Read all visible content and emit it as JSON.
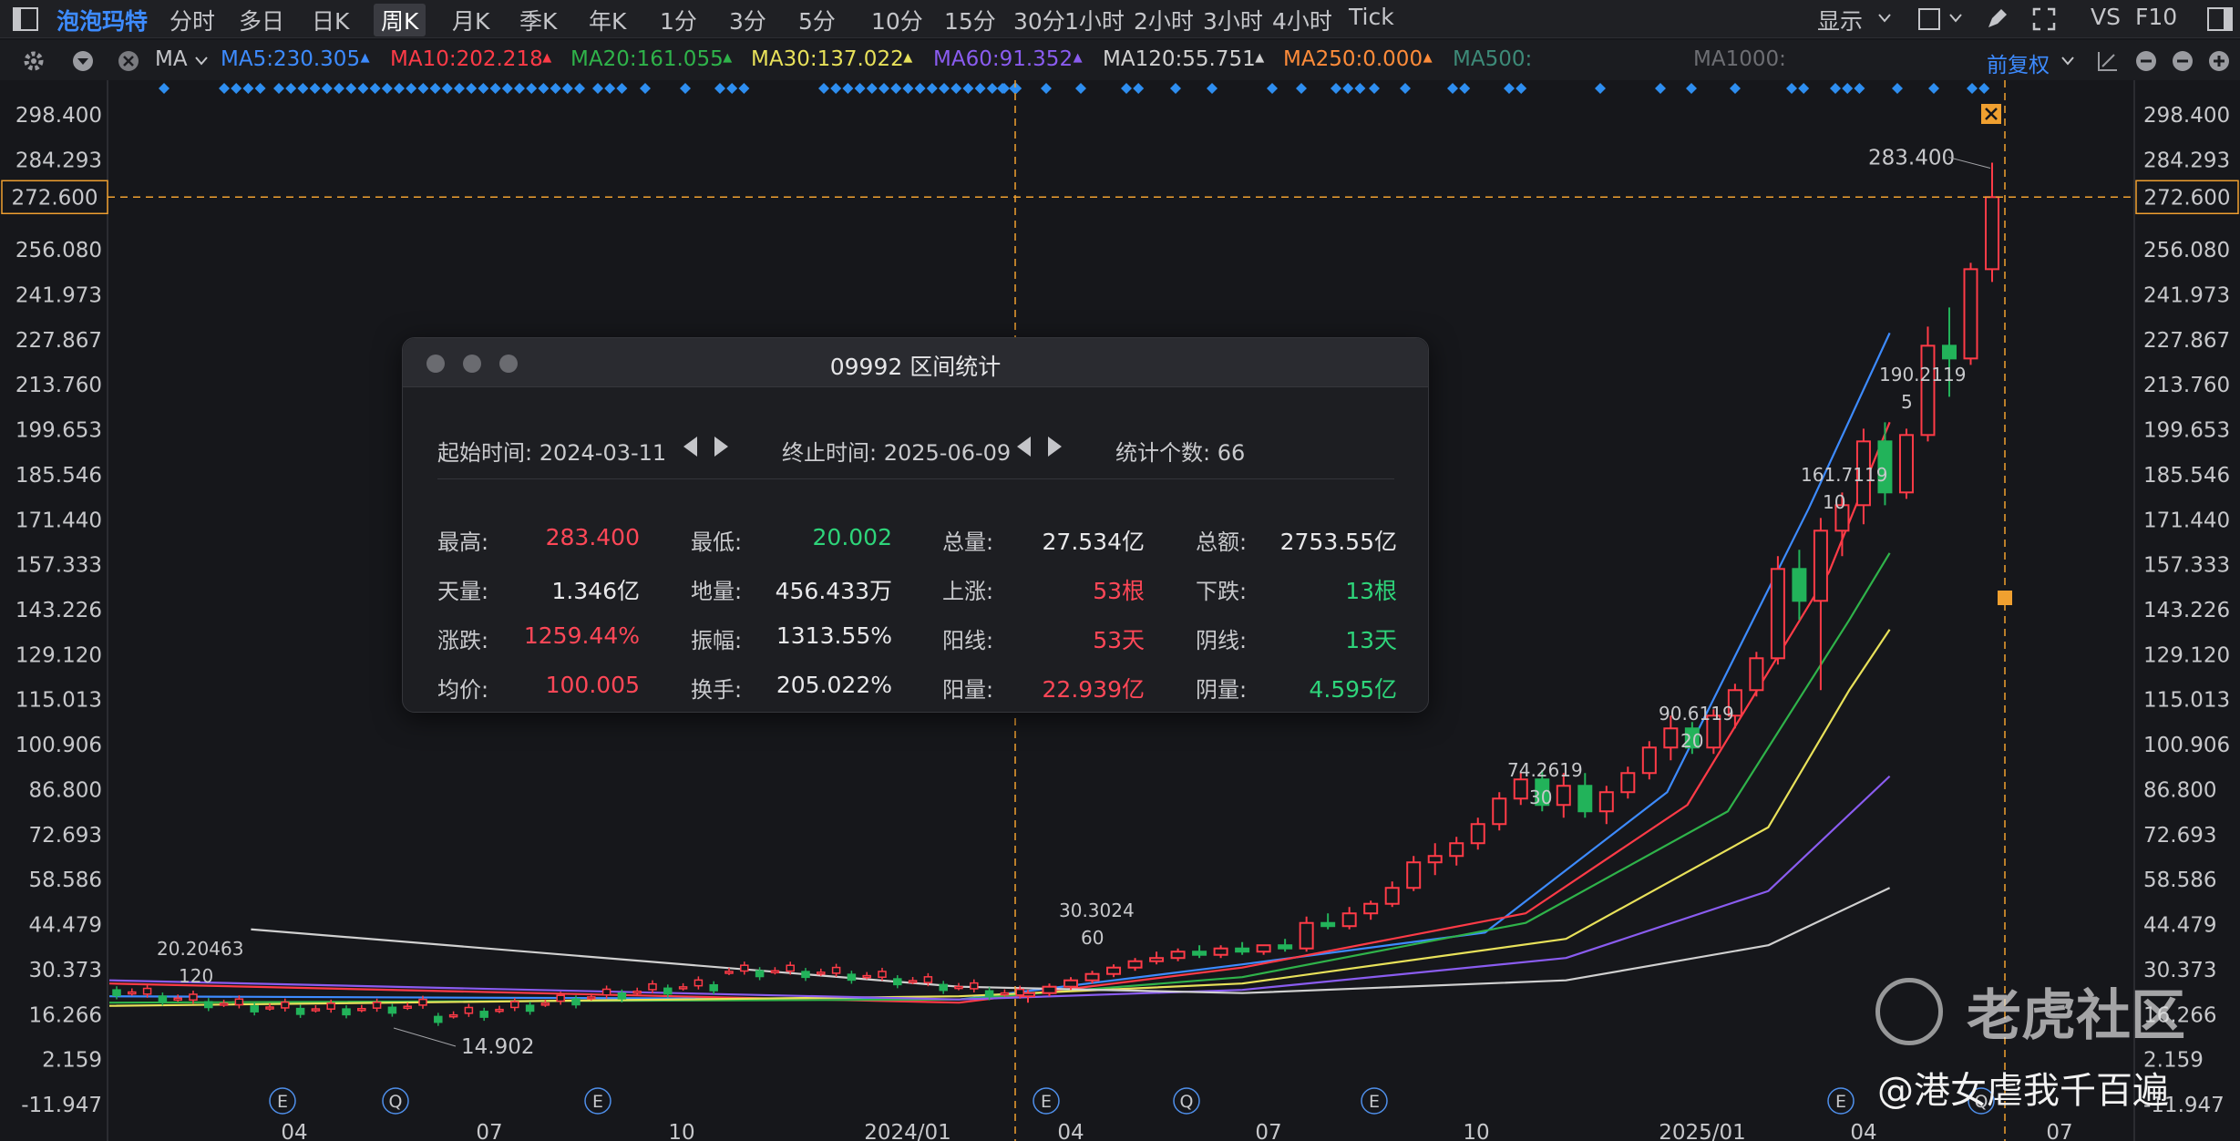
{
  "toolbar": {
    "stock_name": "泡泡玛特",
    "tabs": [
      "分时",
      "多日",
      "日K",
      "周K",
      "月K",
      "季K",
      "年K",
      "1分",
      "3分",
      "5分",
      "10分",
      "15分",
      "30分",
      "1小时",
      "2小时",
      "3小时",
      "4小时",
      "Tick"
    ],
    "active_tab": "周K",
    "display_label": "显示",
    "vs_label": "VS",
    "f10_label": "F10"
  },
  "ma_bar": {
    "indicator": "MA",
    "items": [
      {
        "text": "MA5:230.305",
        "color": "#3d8bff"
      },
      {
        "text": "MA10:202.218",
        "color": "#ff3b47"
      },
      {
        "text": "MA20:161.055",
        "color": "#2fb34a"
      },
      {
        "text": "MA30:137.022",
        "color": "#e8e15a"
      },
      {
        "text": "MA60:91.352",
        "color": "#8a5cf0"
      },
      {
        "text": "MA120:55.751",
        "color": "#d0d0d0"
      },
      {
        "text": "MA250:0.000",
        "color": "#ff8c3a"
      },
      {
        "text": "MA500:",
        "color": "#3d8a78"
      },
      {
        "text": "MA1000:",
        "color": "#6d6e73"
      }
    ],
    "adjust_label": "前复权"
  },
  "y_axis": {
    "ticks": [
      "298.400",
      "284.293",
      "256.080",
      "241.973",
      "227.867",
      "213.760",
      "199.653",
      "185.546",
      "171.440",
      "157.333",
      "143.226",
      "129.120",
      "115.013",
      "100.906",
      "86.800",
      "72.693",
      "58.586",
      "44.479",
      "30.373",
      "16.266",
      "2.159",
      "-11.947"
    ],
    "crosshair_value": "272.600"
  },
  "x_axis": {
    "ticks": [
      "04",
      "07",
      "10",
      "2024/01",
      "04",
      "07",
      "10",
      "2025/01",
      "04",
      "07"
    ]
  },
  "annotations": {
    "high_label": "283.400",
    "low_label": "14.902",
    "ma_markers": [
      {
        "value": "20.20463",
        "period": "120"
      },
      {
        "value": "30.3024",
        "period": "60"
      },
      {
        "value": "74.2619",
        "period": "30"
      },
      {
        "value": "90.6119",
        "period": "20"
      },
      {
        "value": "161.7119",
        "period": "10"
      },
      {
        "value": "190.2119",
        "period": "5"
      }
    ],
    "event_badges": [
      "E",
      "Q",
      "E",
      "E",
      "Q",
      "E",
      "E",
      "Q"
    ]
  },
  "stats_window": {
    "title": "09992 区间统计",
    "start_label": "起始时间: 2024-03-11",
    "end_label": "终止时间: 2025-06-09",
    "count_label": "统计个数: 66",
    "rows": [
      [
        {
          "label": "最高:",
          "value": "283.400",
          "color": "red"
        },
        {
          "label": "最低:",
          "value": "20.002",
          "color": "green"
        },
        {
          "label": "总量:",
          "value": "27.534亿",
          "color": "white"
        },
        {
          "label": "总额:",
          "value": "2753.55亿",
          "color": "white"
        }
      ],
      [
        {
          "label": "天量:",
          "value": "1.346亿",
          "color": "white"
        },
        {
          "label": "地量:",
          "value": "456.433万",
          "color": "white"
        },
        {
          "label": "上涨:",
          "value": "53根",
          "color": "red"
        },
        {
          "label": "下跌:",
          "value": "13根",
          "color": "green"
        }
      ],
      [
        {
          "label": "涨跌:",
          "value": "1259.44%",
          "color": "red"
        },
        {
          "label": "振幅:",
          "value": "1313.55%",
          "color": "white"
        },
        {
          "label": "阳线:",
          "value": "53天",
          "color": "red"
        },
        {
          "label": "阴线:",
          "value": "13天",
          "color": "green"
        }
      ],
      [
        {
          "label": "均价:",
          "value": "100.005",
          "color": "red"
        },
        {
          "label": "换手:",
          "value": "205.022%",
          "color": "white"
        },
        {
          "label": "阳量:",
          "value": "22.939亿",
          "color": "red"
        },
        {
          "label": "阴量:",
          "value": "4.595亿",
          "color": "green"
        }
      ]
    ]
  },
  "watermark": {
    "brand": "老虎社区",
    "handle": "@港女虐我千百遍"
  },
  "chart_data": {
    "type": "candlestick",
    "y_range": [
      -11.947,
      298.4
    ],
    "ma_lines": [
      {
        "name": "MA5",
        "color": "#3d8bff",
        "x": [
          0.0,
          0.42,
          0.56,
          0.68,
          0.77,
          0.84,
          0.88
        ],
        "y": [
          22,
          21,
          32,
          42,
          86,
          175,
          230
        ]
      },
      {
        "name": "MA10",
        "color": "#ff3b47",
        "x": [
          0.0,
          0.42,
          0.56,
          0.7,
          0.78,
          0.85,
          0.88
        ],
        "y": [
          26,
          20,
          31,
          48,
          82,
          155,
          202
        ]
      },
      {
        "name": "MA20",
        "color": "#2fb34a",
        "x": [
          0.0,
          0.42,
          0.56,
          0.7,
          0.8,
          0.86,
          0.88
        ],
        "y": [
          20,
          21,
          28,
          45,
          80,
          140,
          161
        ]
      },
      {
        "name": "MA30",
        "color": "#e8e15a",
        "x": [
          0.0,
          0.42,
          0.56,
          0.72,
          0.82,
          0.86,
          0.88
        ],
        "y": [
          19,
          22,
          26,
          40,
          75,
          118,
          137
        ]
      },
      {
        "name": "MA60",
        "color": "#8a5cf0",
        "x": [
          0.0,
          0.42,
          0.56,
          0.72,
          0.82,
          0.88
        ],
        "y": [
          27,
          21,
          24,
          34,
          55,
          91
        ]
      },
      {
        "name": "MA120",
        "color": "#d0d0d0",
        "x": [
          0.07,
          0.42,
          0.56,
          0.72,
          0.82,
          0.88
        ],
        "y": [
          43,
          25,
          23,
          27,
          38,
          56
        ]
      }
    ],
    "candles_recent": [
      {
        "o": 22,
        "h": 24,
        "l": 20,
        "c": 23
      },
      {
        "o": 23,
        "h": 26,
        "l": 22,
        "c": 25
      },
      {
        "o": 25,
        "h": 28,
        "l": 24,
        "c": 27
      },
      {
        "o": 27,
        "h": 30,
        "l": 26,
        "c": 29
      },
      {
        "o": 29,
        "h": 32,
        "l": 28,
        "c": 31
      },
      {
        "o": 31,
        "h": 34,
        "l": 30,
        "c": 33
      },
      {
        "o": 33,
        "h": 36,
        "l": 32,
        "c": 34
      },
      {
        "o": 34,
        "h": 37,
        "l": 33,
        "c": 36
      },
      {
        "o": 36,
        "h": 38,
        "l": 34,
        "c": 35
      },
      {
        "o": 35,
        "h": 38,
        "l": 34,
        "c": 37
      },
      {
        "o": 37,
        "h": 39,
        "l": 35,
        "c": 36
      },
      {
        "o": 36,
        "h": 38,
        "l": 35,
        "c": 38
      },
      {
        "o": 38,
        "h": 40,
        "l": 36,
        "c": 37
      },
      {
        "o": 37,
        "h": 47,
        "l": 36,
        "c": 45
      },
      {
        "o": 45,
        "h": 48,
        "l": 43,
        "c": 44
      },
      {
        "o": 44,
        "h": 50,
        "l": 43,
        "c": 48
      },
      {
        "o": 48,
        "h": 52,
        "l": 46,
        "c": 51
      },
      {
        "o": 51,
        "h": 58,
        "l": 50,
        "c": 56
      },
      {
        "o": 56,
        "h": 66,
        "l": 55,
        "c": 64
      },
      {
        "o": 64,
        "h": 70,
        "l": 60,
        "c": 66
      },
      {
        "o": 66,
        "h": 72,
        "l": 63,
        "c": 70
      },
      {
        "o": 70,
        "h": 78,
        "l": 68,
        "c": 76
      },
      {
        "o": 76,
        "h": 86,
        "l": 74,
        "c": 84
      },
      {
        "o": 84,
        "h": 92,
        "l": 82,
        "c": 90
      },
      {
        "o": 90,
        "h": 93,
        "l": 80,
        "c": 82
      },
      {
        "o": 82,
        "h": 92,
        "l": 78,
        "c": 88
      },
      {
        "o": 88,
        "h": 92,
        "l": 78,
        "c": 80
      },
      {
        "o": 80,
        "h": 88,
        "l": 76,
        "c": 86
      },
      {
        "o": 86,
        "h": 94,
        "l": 84,
        "c": 92
      },
      {
        "o": 92,
        "h": 102,
        "l": 90,
        "c": 100
      },
      {
        "o": 100,
        "h": 110,
        "l": 96,
        "c": 106
      },
      {
        "o": 106,
        "h": 108,
        "l": 98,
        "c": 100
      },
      {
        "o": 100,
        "h": 112,
        "l": 98,
        "c": 110
      },
      {
        "o": 110,
        "h": 120,
        "l": 106,
        "c": 118
      },
      {
        "o": 118,
        "h": 130,
        "l": 116,
        "c": 128
      },
      {
        "o": 128,
        "h": 160,
        "l": 126,
        "c": 156
      },
      {
        "o": 156,
        "h": 162,
        "l": 140,
        "c": 146
      },
      {
        "o": 146,
        "h": 172,
        "l": 118,
        "c": 168
      },
      {
        "o": 168,
        "h": 180,
        "l": 160,
        "c": 176
      },
      {
        "o": 176,
        "h": 200,
        "l": 170,
        "c": 196
      },
      {
        "o": 196,
        "h": 202,
        "l": 176,
        "c": 180
      },
      {
        "o": 180,
        "h": 200,
        "l": 178,
        "c": 198
      },
      {
        "o": 198,
        "h": 232,
        "l": 196,
        "c": 226
      },
      {
        "o": 226,
        "h": 238,
        "l": 210,
        "c": 222
      },
      {
        "o": 222,
        "h": 252,
        "l": 220,
        "c": 250
      },
      {
        "o": 250,
        "h": 283.4,
        "l": 246,
        "c": 272.6
      }
    ]
  }
}
